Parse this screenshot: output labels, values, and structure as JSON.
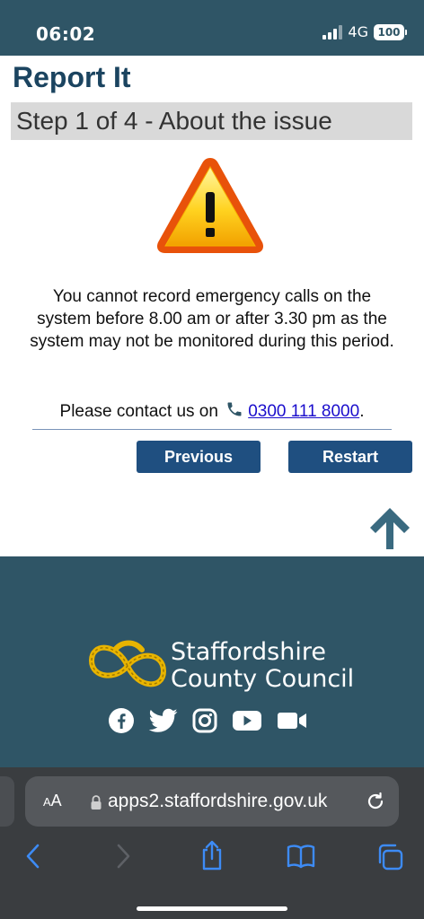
{
  "status": {
    "time": "06:02",
    "network": "4G",
    "battery": "100"
  },
  "page": {
    "title": "Report It",
    "step": "Step 1 of 4 - About the issue",
    "message": "You cannot record emergency calls on the system before 8.00 am or after 3.30 pm as the system may not be monitored during this period.",
    "contact_prefix": "Please contact us on",
    "phone": "0300 111 8000",
    "contact_suffix": ".",
    "buttons": {
      "previous": "Previous",
      "restart": "Restart"
    }
  },
  "footer": {
    "council_line1": "Staffordshire",
    "council_line2": "County Council",
    "socials": [
      "facebook-icon",
      "twitter-icon",
      "instagram-icon",
      "youtube-icon",
      "video-icon"
    ]
  },
  "browser": {
    "aa_label_small": "A",
    "aa_label_large": "A",
    "url": "apps2.staffordshire.gov.uk"
  },
  "colors": {
    "header_bg": "#2f5566",
    "title": "#1b4460",
    "button": "#1f4f80",
    "link": "#1a0dcc",
    "logo_gold": "#e8b400"
  }
}
